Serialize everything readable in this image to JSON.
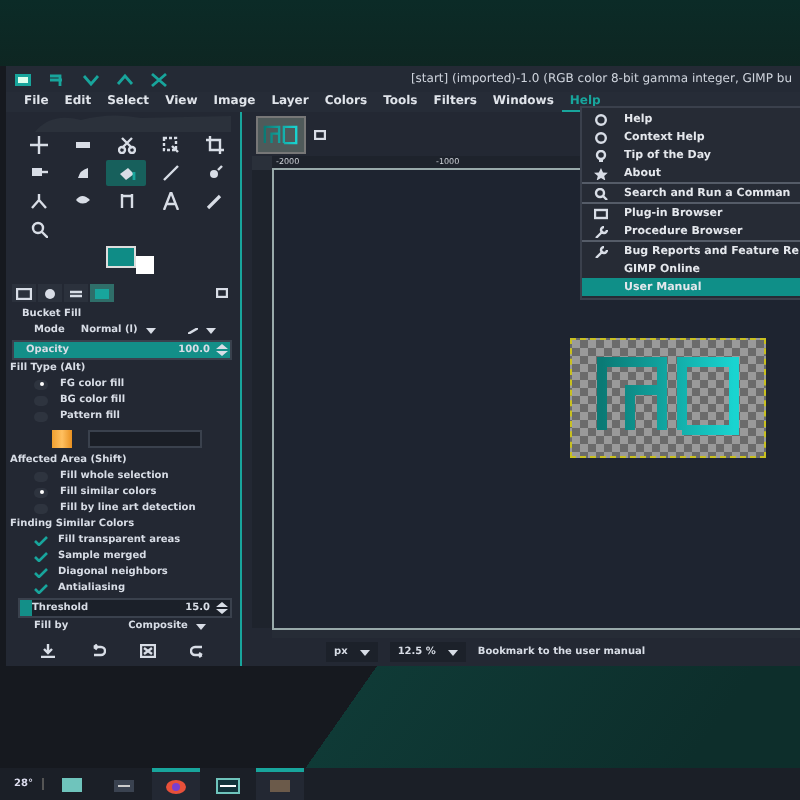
{
  "window": {
    "title": "[start] (imported)-1.0 (RGB color 8-bit gamma integer, GIMP bu"
  },
  "menu_bar": [
    {
      "label": "File",
      "selected": false
    },
    {
      "label": "Edit",
      "selected": false
    },
    {
      "label": "Select",
      "selected": false
    },
    {
      "label": "View",
      "selected": false
    },
    {
      "label": "Image",
      "selected": false
    },
    {
      "label": "Layer",
      "selected": false
    },
    {
      "label": "Colors",
      "selected": false
    },
    {
      "label": "Tools",
      "selected": false
    },
    {
      "label": "Filters",
      "selected": false
    },
    {
      "label": "Windows",
      "selected": false
    },
    {
      "label": "Help",
      "selected": true
    }
  ],
  "help_menu": [
    {
      "kind": "item",
      "label": "Help",
      "selected": false
    },
    {
      "kind": "item",
      "label": "Context Help",
      "selected": false
    },
    {
      "kind": "item",
      "label": "Tip of the Day",
      "selected": false
    },
    {
      "kind": "item",
      "label": "About",
      "selected": false
    },
    {
      "kind": "separator"
    },
    {
      "kind": "item",
      "label": "Search and Run a Comman",
      "selected": false
    },
    {
      "kind": "separator"
    },
    {
      "kind": "item",
      "label": "Plug-in Browser",
      "selected": false
    },
    {
      "kind": "item",
      "label": "Procedure Browser",
      "selected": false
    },
    {
      "kind": "separator"
    },
    {
      "kind": "item",
      "label": "Bug Reports and Feature Re",
      "selected": false
    },
    {
      "kind": "item",
      "label": "GIMP Online",
      "selected": false
    },
    {
      "kind": "item",
      "label": "User Manual",
      "selected": true
    }
  ],
  "toolbox": [
    {
      "selected": false
    },
    {
      "selected": false
    },
    {
      "selected": false
    },
    {
      "selected": false
    },
    {
      "selected": false
    },
    {
      "selected": false
    },
    {
      "selected": false
    },
    {
      "selected": true
    },
    {
      "selected": false
    },
    {
      "selected": false
    },
    {
      "selected": false
    },
    {
      "selected": false
    },
    {
      "selected": false
    },
    {
      "selected": false
    },
    {
      "selected": false
    },
    {
      "selected": false
    }
  ],
  "dock_tabs": [
    {
      "selected": false
    },
    {
      "selected": false
    },
    {
      "selected": false
    },
    {
      "selected": true
    }
  ],
  "tool_options": {
    "title": "Bucket Fill",
    "mode": {
      "label": "Mode",
      "value": "Normal (l)"
    },
    "opacity": {
      "label": "Opacity",
      "value": "100.0",
      "level": 1
    },
    "fill_type": {
      "label": "Fill Type (Alt)",
      "options": [
        {
          "label": "FG color fill",
          "selected": true
        },
        {
          "label": "BG color fill",
          "selected": false
        },
        {
          "label": "Pattern fill",
          "selected": false
        }
      ]
    },
    "affected_area": {
      "label": "Affected Area (Shift)",
      "options": [
        {
          "label": "Fill whole selection",
          "selected": false
        },
        {
          "label": "Fill similar colors",
          "selected": true
        },
        {
          "label": "Fill by line art detection",
          "selected": false
        }
      ]
    },
    "similar_colors": {
      "label": "Finding Similar Colors",
      "options": [
        {
          "label": "Fill transparent areas",
          "checked": true
        },
        {
          "label": "Sample merged",
          "checked": true
        },
        {
          "label": "Diagonal neighbors",
          "checked": true
        },
        {
          "label": "Antialiasing",
          "checked": true
        }
      ]
    },
    "threshold": {
      "label": "Threshold",
      "value": "15.0",
      "level": 0.06
    },
    "fill_by": {
      "label": "Fill by",
      "value": "Composite"
    }
  },
  "canvas": {
    "ruler_labels": [
      "-2000",
      "-1000"
    ]
  },
  "status_bar": {
    "unit": "px",
    "zoom": "12.5 %",
    "message": "Bookmark to the user manual"
  },
  "taskbar": {
    "weather": "28°",
    "apps": [
      {
        "active": false
      },
      {
        "active": false
      },
      {
        "active": true
      },
      {
        "active": false
      },
      {
        "active": true
      }
    ]
  }
}
